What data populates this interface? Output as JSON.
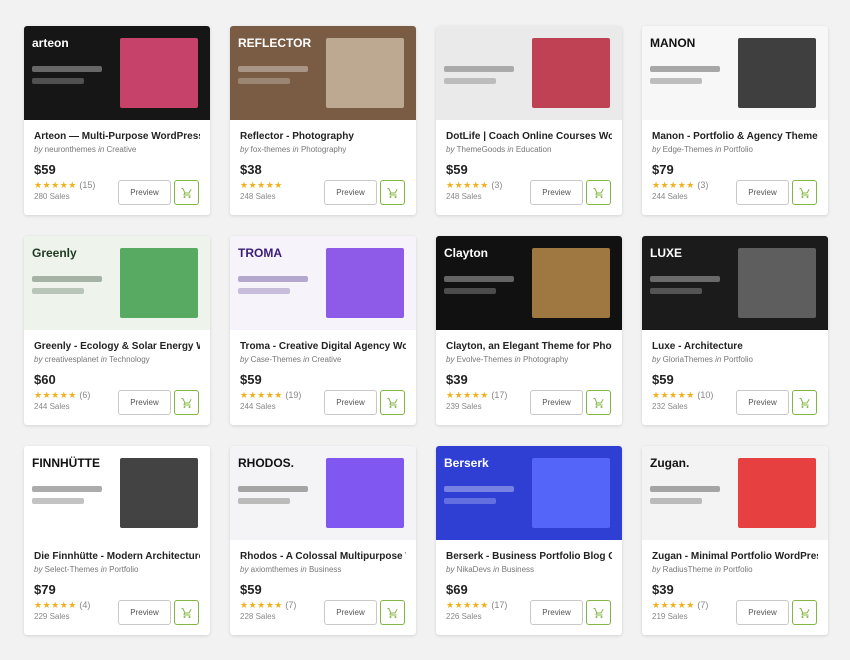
{
  "items": [
    {
      "title": "Arteon — Multi-Purpose WordPress Theme",
      "author": "neuronthemes",
      "category": "Creative",
      "price": "$59",
      "reviews": "(15)",
      "sales": "280 Sales",
      "thumb_text": "arteon",
      "thumb_bg": "#161616",
      "thumb_fg": "#ffffff",
      "accent": "#e64a7a"
    },
    {
      "title": "Reflector - Photography",
      "author": "fox-themes",
      "category": "Photography",
      "price": "$38",
      "reviews": "",
      "sales": "248 Sales",
      "thumb_text": "REFLECTOR",
      "thumb_bg": "#7a5c45",
      "thumb_fg": "#ffffff",
      "accent": "#c9b59f"
    },
    {
      "title": "DotLife | Coach Online Courses WordPress Theme",
      "author": "ThemeGoods",
      "category": "Education",
      "price": "$59",
      "reviews": "(3)",
      "sales": "248 Sales",
      "thumb_text": "",
      "thumb_bg": "#eaeaea",
      "thumb_fg": "#333333",
      "accent": "#b7243a"
    },
    {
      "title": "Manon - Portfolio & Agency Theme",
      "author": "Edge-Themes",
      "category": "Portfolio",
      "price": "$79",
      "reviews": "(3)",
      "sales": "244 Sales",
      "thumb_text": "MANON",
      "thumb_bg": "#f7f7f7",
      "thumb_fg": "#111111",
      "accent": "#1e1e1e"
    },
    {
      "title": "Greenly - Ecology & Solar Energy WordPress Theme",
      "author": "creativesplanet",
      "category": "Technology",
      "price": "$60",
      "reviews": "(6)",
      "sales": "244 Sales",
      "thumb_text": "Greenly",
      "thumb_bg": "#eef3ec",
      "thumb_fg": "#1f3a22",
      "accent": "#3d9b4a"
    },
    {
      "title": "Troma - Creative Digital Agency WordPress Theme",
      "author": "Case-Themes",
      "category": "Creative",
      "price": "$59",
      "reviews": "(19)",
      "sales": "244 Sales",
      "thumb_text": "TROMA",
      "thumb_bg": "#f6f3fb",
      "thumb_fg": "#3a1d7a",
      "accent": "#7b3fe4"
    },
    {
      "title": "Clayton, an Elegant Theme for Photographers",
      "author": "Evolve-Themes",
      "category": "Photography",
      "price": "$39",
      "reviews": "(17)",
      "sales": "239 Sales",
      "thumb_text": "Clayton",
      "thumb_bg": "#111111",
      "thumb_fg": "#ffffff",
      "accent": "#b88a4a"
    },
    {
      "title": "Luxe - Architecture",
      "author": "GloriaThemes",
      "category": "Portfolio",
      "price": "$59",
      "reviews": "(10)",
      "sales": "232 Sales",
      "thumb_text": "LUXE",
      "thumb_bg": "#1b1b1b",
      "thumb_fg": "#ffffff",
      "accent": "#6a6a6a"
    },
    {
      "title": "Die Finnhütte - Modern Architecture and Interior",
      "author": "Select-Themes",
      "category": "Portfolio",
      "price": "$79",
      "reviews": "(4)",
      "sales": "229 Sales",
      "thumb_text": "FINNHÜTTE",
      "thumb_bg": "#ffffff",
      "thumb_fg": "#111111",
      "accent": "#222222"
    },
    {
      "title": "Rhodos - A Colossal Multipurpose WordPress Theme",
      "author": "axiomthemes",
      "category": "Business",
      "price": "$59",
      "reviews": "(7)",
      "sales": "228 Sales",
      "thumb_text": "RHODOS.",
      "thumb_bg": "#f4f4f6",
      "thumb_fg": "#111111",
      "accent": "#6b3cf0"
    },
    {
      "title": "Berserk - Business Portfolio Blog Corporate",
      "author": "NikaDevs",
      "category": "Business",
      "price": "$69",
      "reviews": "(17)",
      "sales": "226 Sales",
      "thumb_text": "Berserk",
      "thumb_bg": "#2f3fd4",
      "thumb_fg": "#ffffff",
      "accent": "#5b6cff"
    },
    {
      "title": "Zugan - Minimal Portfolio WordPress Theme",
      "author": "RadiusTheme",
      "category": "Portfolio",
      "price": "$39",
      "reviews": "(7)",
      "sales": "219 Sales",
      "thumb_text": "Zugan.",
      "thumb_bg": "#f3f3f3",
      "thumb_fg": "#111111",
      "accent": "#e42020"
    }
  ],
  "labels": {
    "by": "by",
    "in": "in",
    "preview": "Preview",
    "stars": "★★★★★"
  },
  "colors": {
    "cart_green": "#82b541",
    "star": "#f2b01e"
  },
  "icons": {
    "cart": "shopping-cart-icon"
  }
}
